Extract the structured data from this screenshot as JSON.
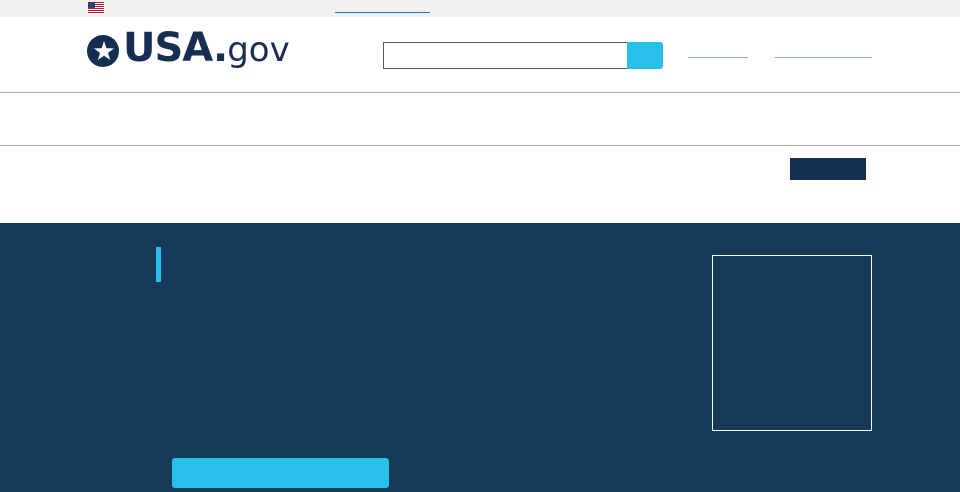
{
  "banner": {
    "flag_icon": "us-flag-icon",
    "text": "",
    "link_label": ""
  },
  "header": {
    "logo": {
      "icon": "star-circle-icon",
      "name": "USA",
      "dot": ".",
      "suffix": "gov"
    },
    "search": {
      "value": "",
      "placeholder": "",
      "button_label": ""
    },
    "links": [
      "",
      ""
    ]
  },
  "nav": {
    "items": []
  },
  "menu_button": {
    "label": ""
  },
  "hero": {
    "title": "",
    "cta_label": ""
  },
  "colors": {
    "navy": "#162e51",
    "hero_blue": "#153a5a",
    "accent_cyan": "#28c0e8",
    "banner_gray": "#f0f0f0"
  }
}
